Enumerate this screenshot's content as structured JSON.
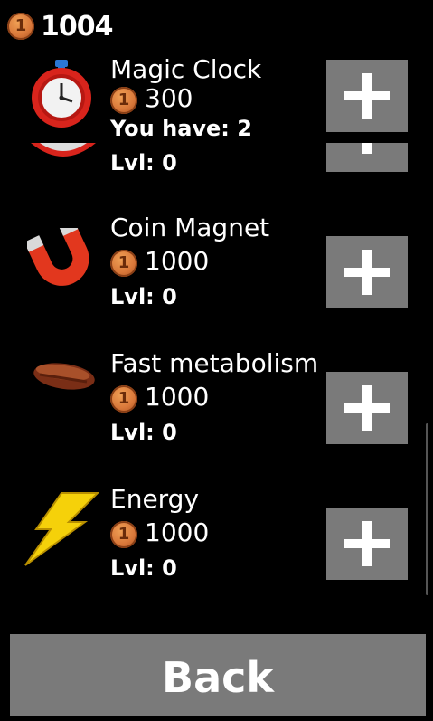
{
  "header": {
    "balance": "1004",
    "coin_label": "1"
  },
  "items": [
    {
      "name": "Magic Clock",
      "price": "300",
      "owned": "You have: 2",
      "level": "Lvl: 0",
      "icon": "stopwatch-icon"
    },
    {
      "name": "",
      "price": "",
      "owned": "",
      "level": "Lvl: 0",
      "icon": "stopwatch-icon"
    },
    {
      "name": "Coin Magnet",
      "price": "1000",
      "level": "Lvl: 0",
      "icon": "magnet-icon"
    },
    {
      "name": "Fast metabolism",
      "price": "1000",
      "level": "Lvl: 0",
      "icon": "sausage-icon"
    },
    {
      "name": "Energy",
      "price": "1000",
      "level": "Lvl: 0",
      "icon": "lightning-icon"
    }
  ],
  "buttons": {
    "add": "+",
    "back": "Back"
  },
  "colors": {
    "button_gray": "#7a7a7a",
    "coin": "#d9783a",
    "background": "#000000",
    "lightning": "#f5d10a"
  }
}
